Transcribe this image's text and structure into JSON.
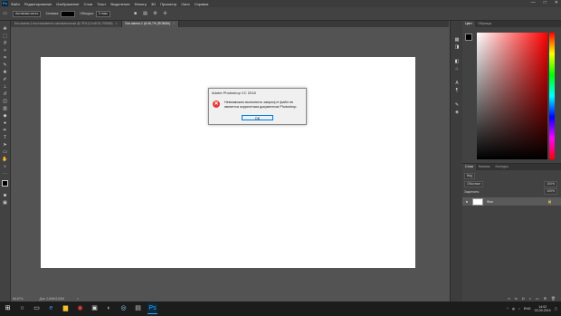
{
  "menubar": {
    "logo": "Ps",
    "items": [
      "Файл",
      "Редактирование",
      "Изображение",
      "Слои",
      "Текст",
      "Выделение",
      "Фильтр",
      "3D",
      "Просмотр",
      "Окно",
      "Справка"
    ],
    "window_controls": [
      "—",
      "□",
      "✕"
    ]
  },
  "optbar": {
    "preset_field": "Активная кисть",
    "size_label": "Заливка:",
    "opacity_label": "Обводка:",
    "size_value": "3 пикс"
  },
  "tabs": [
    {
      "label": "Без имени-1 восстановлено автоматически @ 75% (Слой 15, RGB/8)",
      "close": "×",
      "active": false
    },
    {
      "label": "Без имени-1 @ 66,7% (RGB/8#)",
      "close": "×",
      "active": true
    }
  ],
  "dialog": {
    "title": "Adobe Photoshop CC 2018",
    "message": "Невозможно выполнить запрос(от файл не является корректным документом Photoshop.",
    "ok_label": "OK",
    "error_glyph": "✕"
  },
  "statusbar": {
    "zoom": "66,67%",
    "doc_info": "Док: 2,63M/2,63M"
  },
  "color_panel": {
    "tabs": [
      "Цвет",
      "Образцы"
    ],
    "accent": "#ff0000"
  },
  "layers_panel": {
    "tabs": [
      "Слои",
      "Каналы",
      "Контуры"
    ],
    "kind_filter": "Вид",
    "blend_mode": "Обычные",
    "opacity_value": "100%",
    "lock_label": "Закрепить:",
    "fill_value": "100%",
    "layer_name": "Фон",
    "lock_glyph": "🔒",
    "eye_glyph": "●"
  },
  "taskbar": {
    "time": "14:02",
    "date": "03.09.2019",
    "lang": "ENG"
  },
  "colors": {
    "workspace": "#535353",
    "panel": "#424242",
    "taskbar": "#1c1c1c",
    "ok_border": "#0078d7",
    "error_red": "#e53935"
  }
}
